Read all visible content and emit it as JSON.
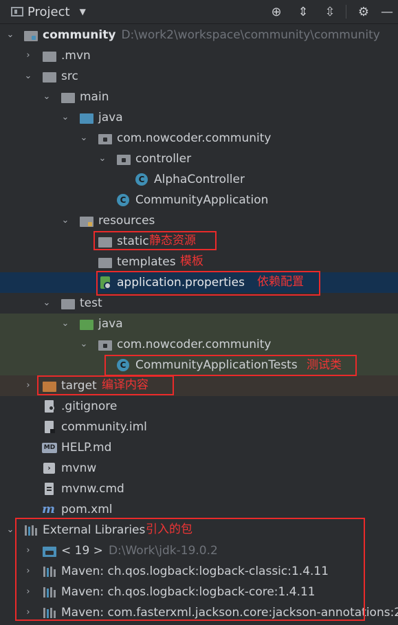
{
  "toolbar": {
    "title": "Project",
    "buttons": [
      "locate-icon",
      "expand-all-icon",
      "collapse-all-icon",
      "gear-icon",
      "hide-icon"
    ]
  },
  "tree": {
    "root": {
      "label": "community",
      "path": "D:\\work2\\workspace\\community\\community"
    },
    "mvn": ".mvn",
    "src": "src",
    "main": "main",
    "java": "java",
    "pkg": "com.nowcoder.community",
    "controller": "controller",
    "alpha": "AlphaController",
    "app": "CommunityApplication",
    "resources": "resources",
    "static": "static",
    "templates": "templates",
    "props": "application.properties",
    "test": "test",
    "test_java": "java",
    "test_pkg": "com.nowcoder.community",
    "app_tests": "CommunityApplicationTests",
    "target": "target",
    "gitignore": ".gitignore",
    "iml": "community.iml",
    "help": "HELP.md",
    "mvnw": "mvnw",
    "mvnw_cmd": "mvnw.cmd",
    "pom": "pom.xml",
    "ext_libs": "External Libraries",
    "jdk": {
      "label": "< 19 >",
      "path": "D:\\Work\\jdk-19.0.2"
    },
    "lib1": "Maven: ch.qos.logback:logback-classic:1.4.11",
    "lib2": "Maven: ch.qos.logback:logback-core:1.4.11",
    "lib3": "Maven: com.fasterxml.jackson.core:jackson-annotations:2"
  },
  "annotations": {
    "static": "静态资源",
    "templates": "模板",
    "props": "依赖配置",
    "tests": "测试类",
    "target": "编译内容",
    "libs": "引入的包"
  },
  "colors": {
    "background": "#2b2d30",
    "selection": "#143150",
    "annotation": "#ea2a2a",
    "folder": "#8f9399",
    "source_folder": "#4a8fb8",
    "test_folder": "#5a9e4f",
    "excluded_folder": "#c07a3c"
  }
}
